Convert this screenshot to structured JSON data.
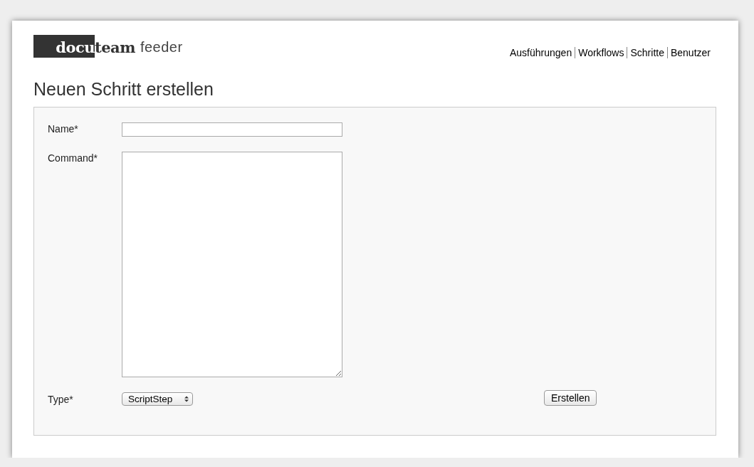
{
  "logo": {
    "part_1": "docu",
    "part_2": "team",
    "part_3": "feeder"
  },
  "nav": [
    {
      "label": "Ausführungen"
    },
    {
      "label": "Workflows"
    },
    {
      "label": "Schritte"
    },
    {
      "label": "Benutzer"
    }
  ],
  "heading": "Neuen Schritt erstellen",
  "form": {
    "fields": [
      {
        "kind": "text",
        "label": "Name*"
      },
      {
        "kind": "textarea",
        "label": "Command*"
      },
      {
        "kind": "select",
        "label": "Type*",
        "value": "ScriptStep"
      }
    ],
    "submit": "Erstellen"
  }
}
